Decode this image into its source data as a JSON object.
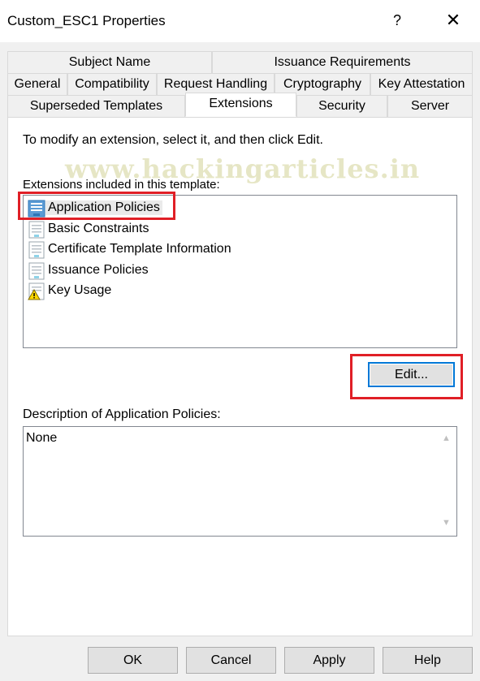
{
  "window": {
    "title": "Custom_ESC1 Properties",
    "help_label": "?",
    "close_label": "✕"
  },
  "tabs": [
    "Subject Name",
    "Issuance Requirements",
    "General",
    "Compatibility",
    "Request Handling",
    "Cryptography",
    "Key Attestation",
    "Superseded Templates",
    "Extensions",
    "Security",
    "Server"
  ],
  "active_tab": "Extensions",
  "watermark": "www.hackingarticles.in",
  "instructions": "To modify an extension, select it, and then click Edit.",
  "extensions": {
    "label": "Extensions included in this template:",
    "items": [
      {
        "label": "Application Policies",
        "icon": "certificate-icon",
        "selected": true
      },
      {
        "label": "Basic Constraints",
        "icon": "certificate-icon"
      },
      {
        "label": "Certificate Template Information",
        "icon": "certificate-icon"
      },
      {
        "label": "Issuance Policies",
        "icon": "certificate-icon"
      },
      {
        "label": "Key Usage",
        "icon": "certificate-warning-icon"
      }
    ]
  },
  "edit_label": "Edit...",
  "description": {
    "label": "Description of Application Policies:",
    "value": "None"
  },
  "buttons": {
    "ok": "OK",
    "cancel": "Cancel",
    "apply": "Apply",
    "help": "Help"
  },
  "colors": {
    "highlight": "#e01f26",
    "focus": "#0078d7"
  }
}
